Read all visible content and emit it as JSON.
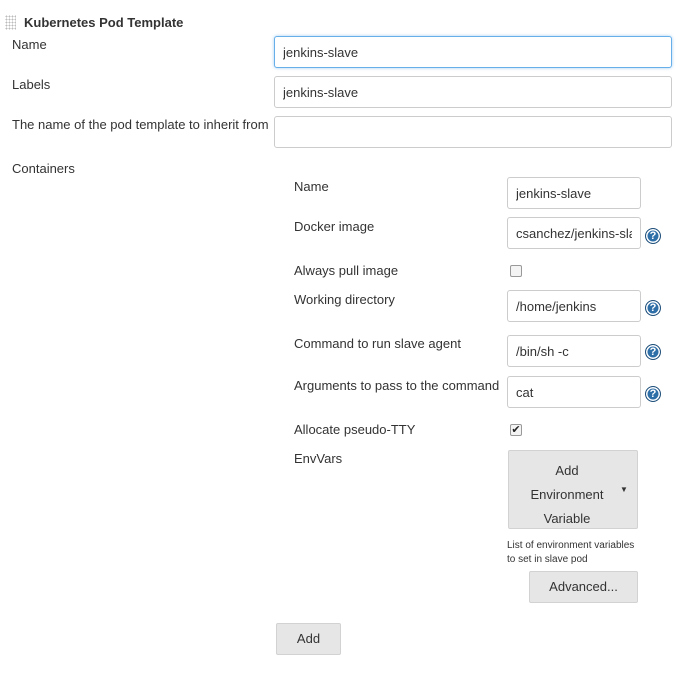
{
  "section": {
    "title": "Kubernetes Pod Template"
  },
  "pod": {
    "name_label": "Name",
    "name_value": "jenkins-slave",
    "labels_label": "Labels",
    "labels_value": "jenkins-slave",
    "inherit_label": "The name of the pod template to inherit from",
    "inherit_value": ""
  },
  "containers": {
    "label": "Containers",
    "name_label": "Name",
    "name_value": "jenkins-slave",
    "docker_image_label": "Docker image",
    "docker_image_value": "csanchez/jenkins-slave",
    "always_pull_label": "Always pull image",
    "always_pull_checked": false,
    "working_dir_label": "Working directory",
    "working_dir_value": "/home/jenkins",
    "command_label": "Command to run slave agent",
    "command_value": "/bin/sh -c",
    "args_label": "Arguments to pass to the command",
    "args_value": "cat",
    "tty_label": "Allocate pseudo-TTY",
    "tty_checked": true,
    "tty_mark": "✔",
    "envvars_label": "EnvVars",
    "add_env_line1": "Add",
    "add_env_line2": "Environment",
    "add_env_line3": "Variable",
    "dropdown_arrow": "▼",
    "envvars_hint_line1": "List of environment variables",
    "envvars_hint_line2": "to set in slave pod",
    "advanced_label": "Advanced..."
  },
  "help_glyph": "?",
  "add_button_label": "Add"
}
